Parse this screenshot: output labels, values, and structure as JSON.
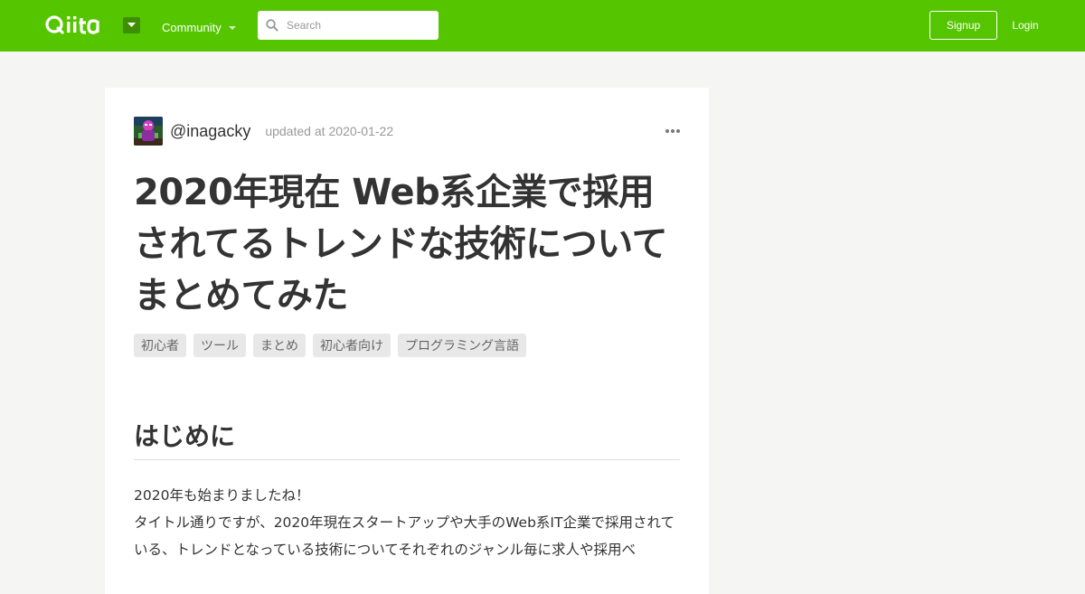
{
  "header": {
    "logo_text": "Qiita",
    "community_label": "Community",
    "search_placeholder": "Search",
    "signup_label": "Signup",
    "login_label": "Login",
    "brand_color": "#55c500"
  },
  "article": {
    "author": "@inagacky",
    "updated_prefix": "updated at",
    "updated_date": "2020-01-22",
    "title": "2020年現在 Web系企業で採用されてるトレンドな技術についてまとめてみた",
    "tags": [
      "初心者",
      "ツール",
      "まとめ",
      "初心者向け",
      "プログラミング言語"
    ],
    "section_heading": "はじめに",
    "paragraphs": [
      "2020年も始まりましたね！",
      "タイトル通りですが、2020年現在スタートアップや大手のWeb系IT企業で採用されている、トレンドとなっている技術についてそれぞれのジャンル毎に求人や採用べ"
    ]
  },
  "icons": {
    "search": "search-icon",
    "more": "more-horizontal-icon",
    "dropdown": "caret-down-icon"
  }
}
